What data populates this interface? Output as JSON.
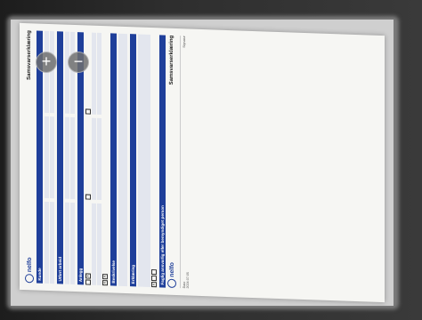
{
  "zoom": {
    "in_label": "+",
    "out_label": "−"
  },
  "document": {
    "logo": "nelfo",
    "title": "Samsvarserklæring",
    "sections": {
      "kunde": "Kunde",
      "utfort": "Utført arbeid",
      "anlegg": "Anlegg",
      "beskrivelse": "Beskrivelse",
      "erklaering": "Erklæring",
      "faglig": "Faglig ansvarlig eller bemyndiget person"
    },
    "footer_date_label": "Dato",
    "footer_date": "2024-07-05",
    "footer_sign_label": "Signatur"
  }
}
